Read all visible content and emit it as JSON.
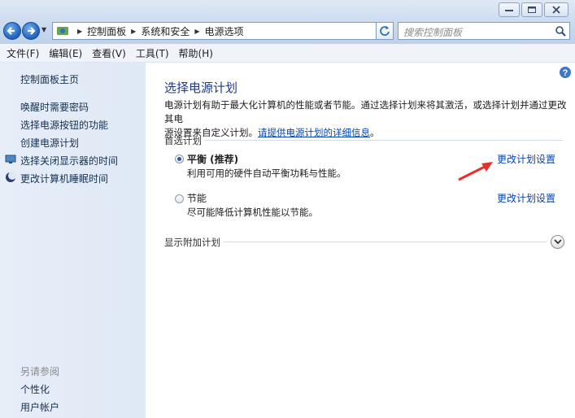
{
  "address": {
    "crumbs": [
      "控制面板",
      "系统和安全",
      "电源选项"
    ]
  },
  "search": {
    "placeholder": "搜索控制面板"
  },
  "menu": [
    "文件(F)",
    "编辑(E)",
    "查看(V)",
    "工具(T)",
    "帮助(H)"
  ],
  "sidebar": {
    "home": "控制面板主页",
    "links": [
      "唤醒时需要密码",
      "选择电源按钮的功能",
      "创建电源计划",
      "选择关闭显示器的时间",
      "更改计算机睡眠时间"
    ],
    "see_also_title": "另请参阅",
    "see_also": [
      "个性化",
      "用户帐户"
    ]
  },
  "main": {
    "title": "选择电源计划",
    "desc_line1": "电源计划有助于最大化计算机的性能或者节能。通过选择计划来将其激活，或选择计划并通过更改其电",
    "desc_line2": "源设置来自定义计划。",
    "desc_link": "请提供电源计划的详细信息",
    "desc_end": "。",
    "preferred_label": "首选计划",
    "plans": [
      {
        "name": "平衡 (推荐)",
        "desc": "利用可用的硬件自动平衡功耗与性能。",
        "link": "更改计划设置",
        "selected": true
      },
      {
        "name": "节能",
        "desc": "尽可能降低计算机性能以节能。",
        "link": "更改计划设置",
        "selected": false
      }
    ],
    "additional_label": "显示附加计划"
  },
  "colors": {
    "link": "#0645ad",
    "title": "#1e3a8a",
    "arrow": "#e8302a"
  }
}
